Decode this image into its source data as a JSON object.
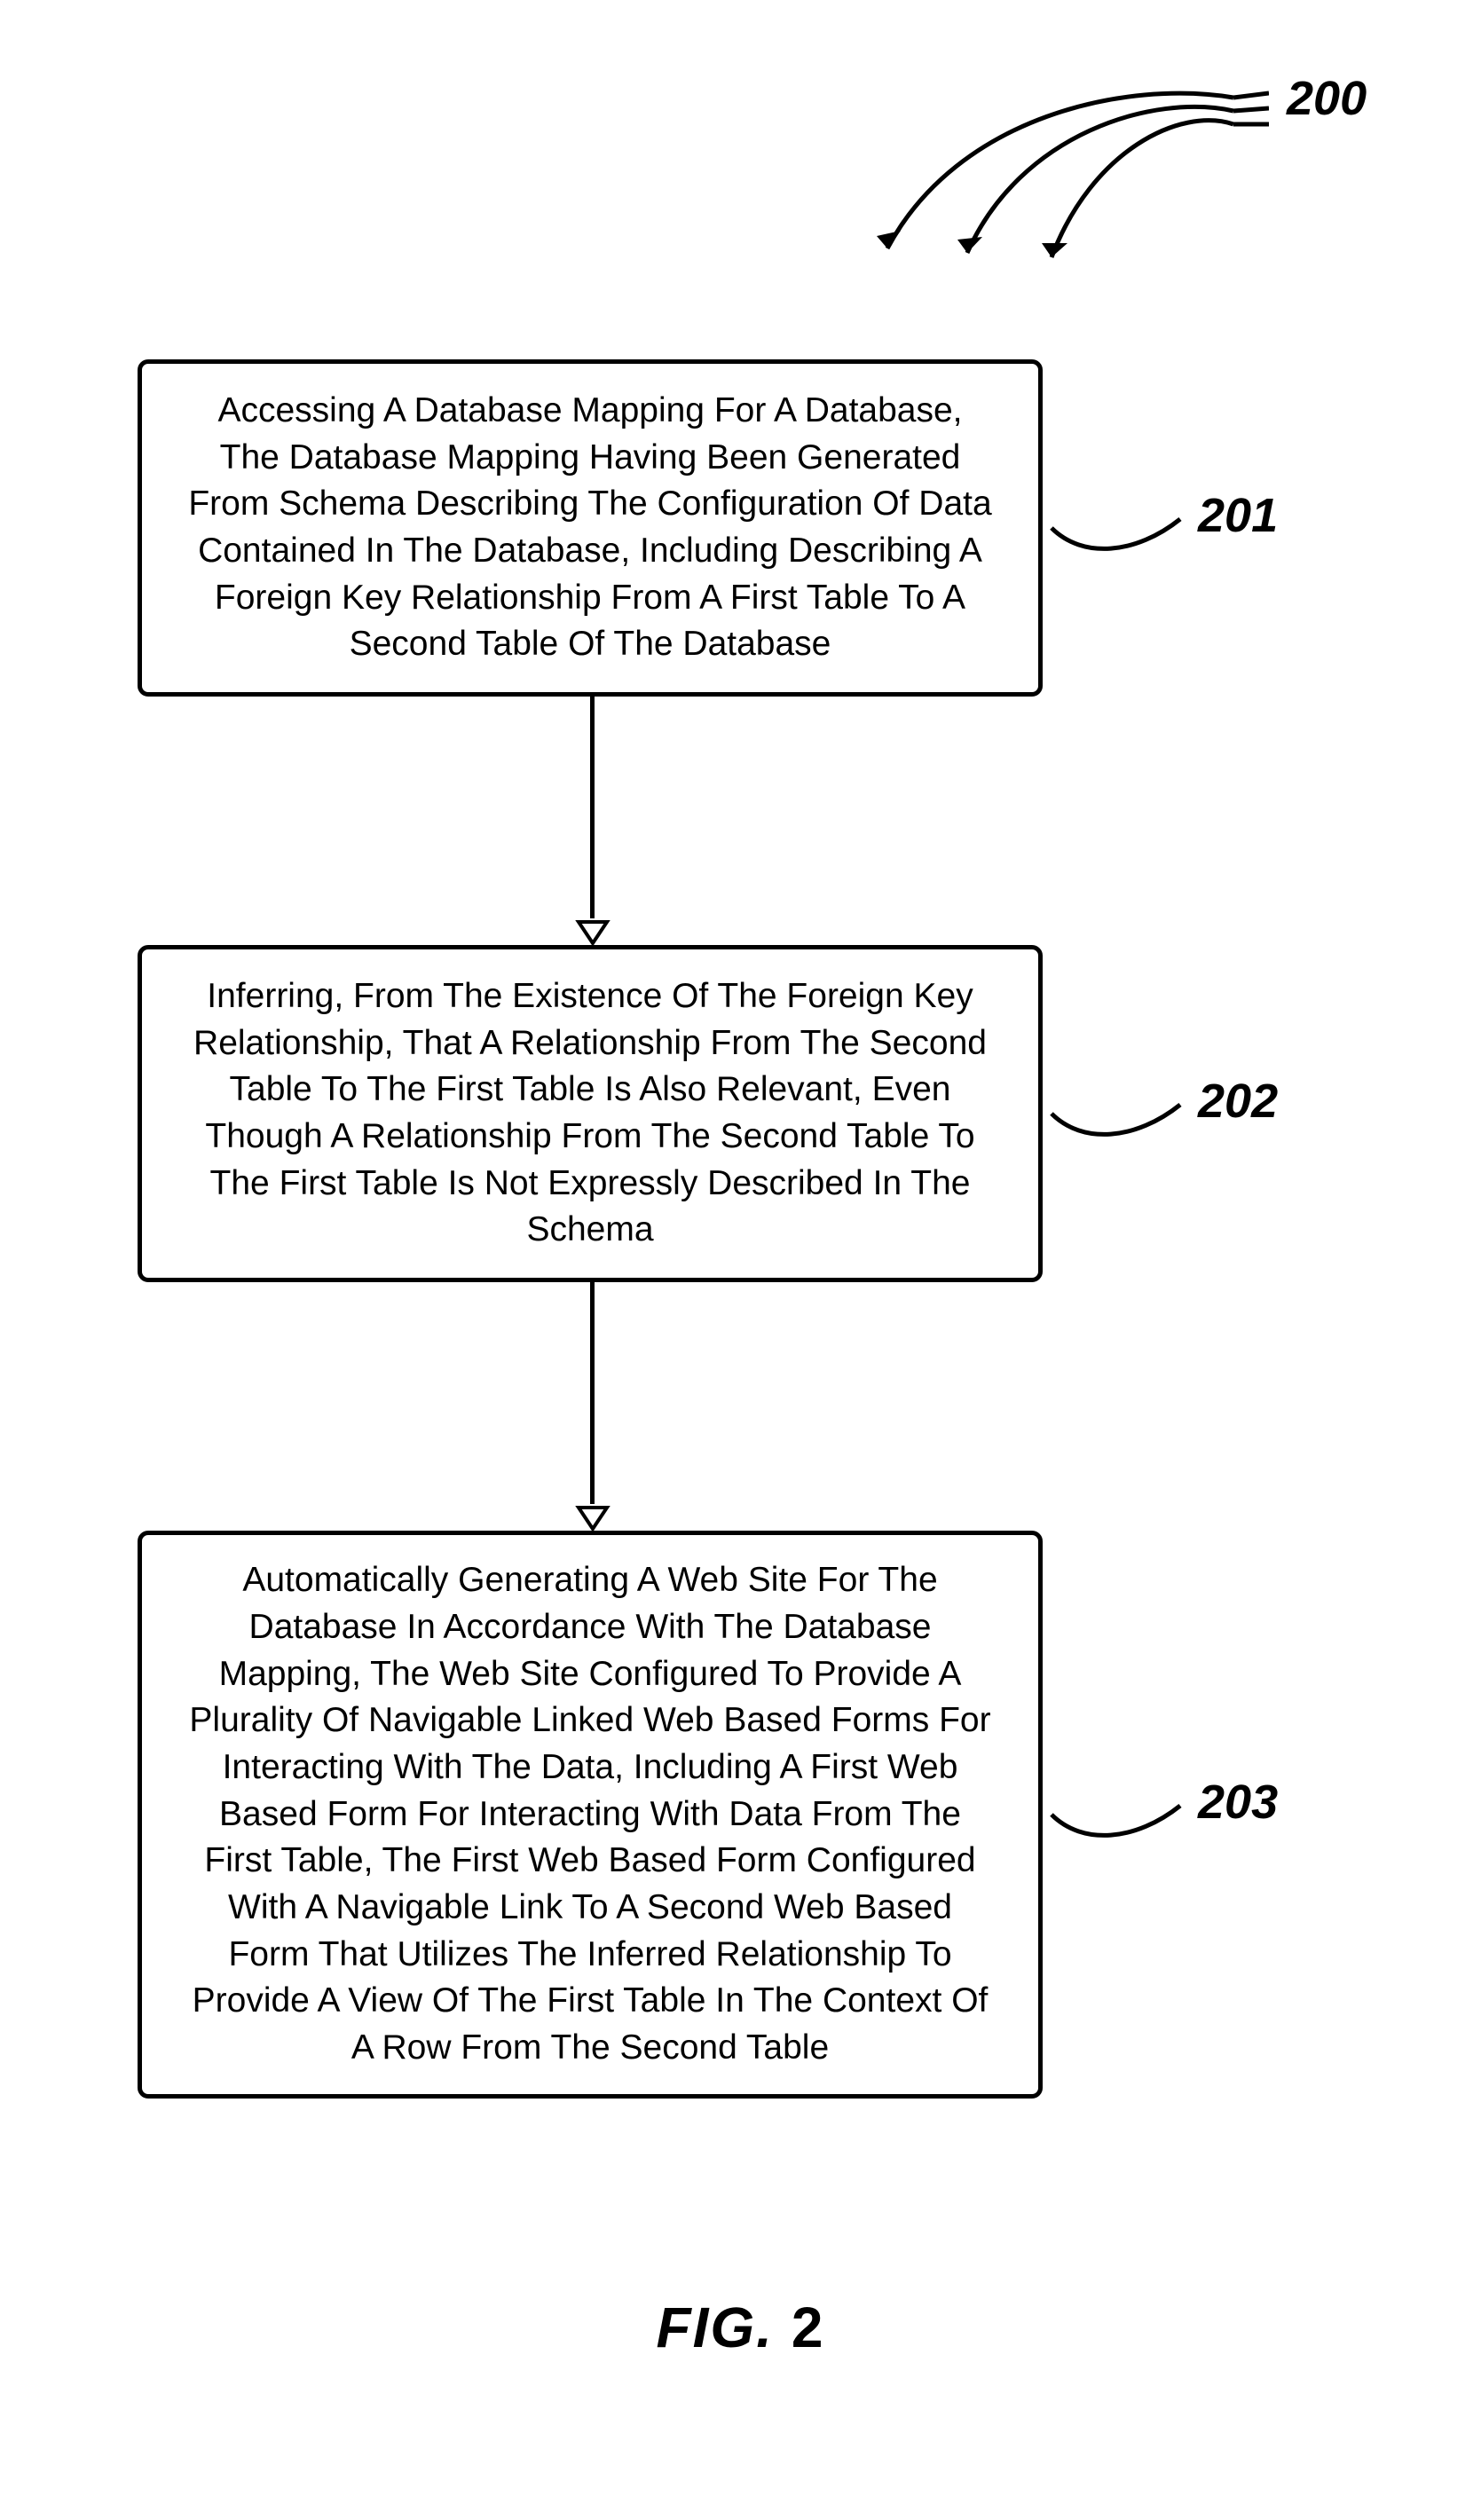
{
  "figure": {
    "label_prefix": "FIG.",
    "label_number": "2",
    "ref_main": "200",
    "steps": [
      {
        "ref": "201",
        "text": "Accessing A Database Mapping For A Database, The Database Mapping Having Been Generated From Schema Describing The Configuration Of Data Contained In The Database, Including Describing A Foreign Key Relationship From A First Table To A Second Table Of The Database"
      },
      {
        "ref": "202",
        "text": "Inferring, From The Existence Of The Foreign Key Relationship, That A Relationship From The Second Table To The First Table Is Also Relevant, Even Though A Relationship From The Second Table To The First Table Is Not Expressly Described In The Schema"
      },
      {
        "ref": "203",
        "text": "Automatically Generating A Web Site For The Database In Accordance With The Database Mapping, The Web Site Configured To Provide A Plurality Of Navigable Linked Web Based Forms For Interacting With The Data, Including A First Web Based Form For Interacting With Data From The First Table, The First Web Based Form Configured With A Navigable Link To A Second Web Based Form That Utilizes The Inferred Relationship To Provide A View Of The First Table In The Context Of A Row From The Second Table"
      }
    ]
  }
}
